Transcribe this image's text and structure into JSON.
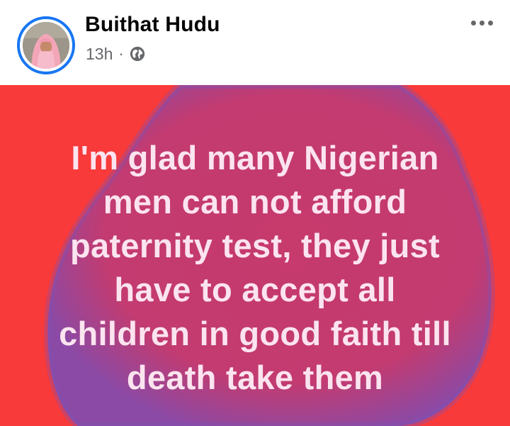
{
  "post": {
    "author_name": "Buithat Hudu",
    "timestamp": "13h",
    "separator": "·",
    "audience_icon": "globe-icon",
    "more_icon": "more-options-icon",
    "avatar_icon": "profile-photo"
  },
  "banner": {
    "background_color": "#f83a3a",
    "blob_color": "#c83a6e",
    "text_color": "#fbe4ef",
    "lines": [
      "I'm glad many Nigerian",
      "men can not afford",
      "paternity test, they just",
      "have to accept all",
      "children in good faith till",
      "death take them"
    ]
  }
}
